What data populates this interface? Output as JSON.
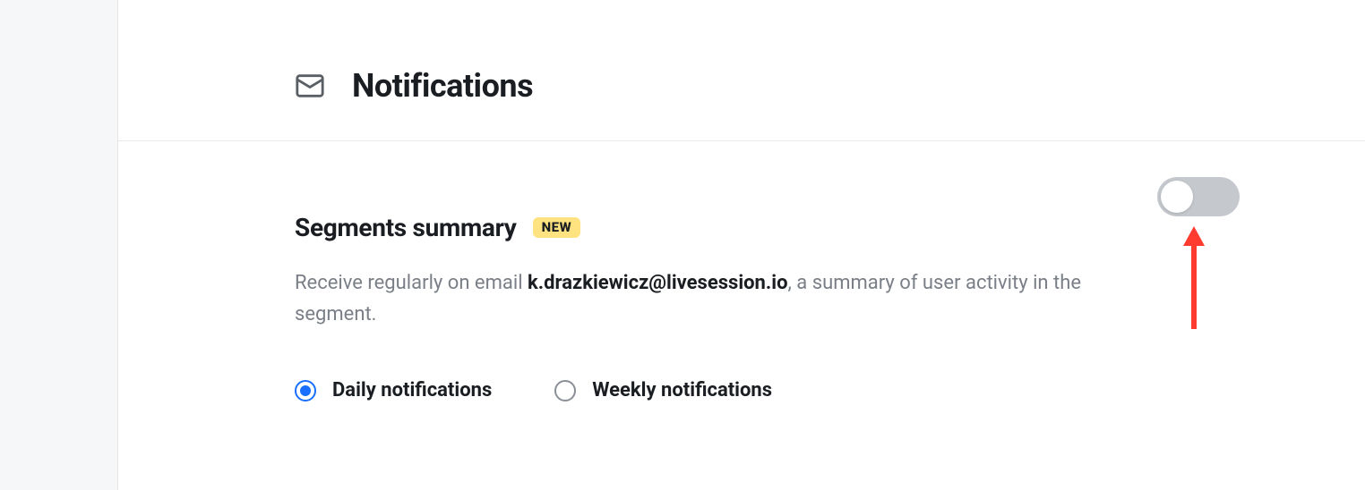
{
  "header": {
    "title": "Notifications"
  },
  "section": {
    "title": "Segments summary",
    "badge": "NEW",
    "desc_prefix": "Receive regularly on email ",
    "desc_email": "k.drazkiewicz@livesession.io",
    "desc_suffix": ", a summary of user activity in the segment."
  },
  "radios": {
    "daily": "Daily notifications",
    "weekly": "Weekly notifications",
    "selected": "daily"
  },
  "toggle": {
    "on": false
  },
  "colors": {
    "accent": "#1a6fff",
    "badge_bg": "#ffe380",
    "annotation_arrow": "#ff3b2f"
  }
}
